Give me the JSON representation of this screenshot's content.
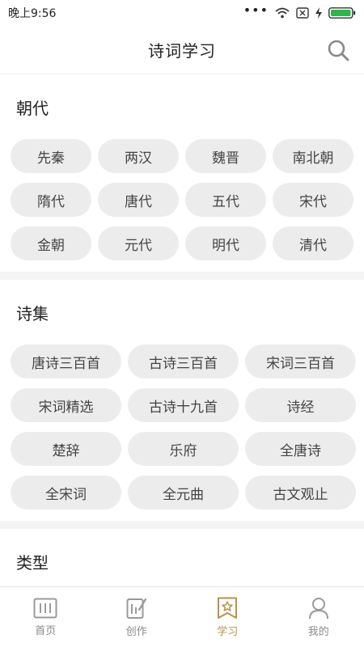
{
  "status_bar": {
    "time": "晚上9:56"
  },
  "header": {
    "title": "诗词学习"
  },
  "sections": {
    "dynasty": {
      "title": "朝代",
      "items": [
        "先秦",
        "两汉",
        "魏晋",
        "南北朝",
        "隋代",
        "唐代",
        "五代",
        "宋代",
        "金朝",
        "元代",
        "明代",
        "清代"
      ]
    },
    "collections": {
      "title": "诗集",
      "items": [
        "唐诗三百首",
        "古诗三百首",
        "宋词三百首",
        "宋词精选",
        "古诗十九首",
        "诗经",
        "楚辞",
        "乐府",
        "全唐诗",
        "全宋词",
        "全元曲",
        "古文观止"
      ]
    },
    "types": {
      "title": "类型"
    }
  },
  "bottom_nav": {
    "items": [
      {
        "label": "首页",
        "icon": "home-icon",
        "active": false
      },
      {
        "label": "创作",
        "icon": "compose-icon",
        "active": false
      },
      {
        "label": "学习",
        "icon": "study-icon",
        "active": true
      },
      {
        "label": "我的",
        "icon": "profile-icon",
        "active": false
      }
    ]
  },
  "colors": {
    "accent": "#b9914a",
    "chip_bg": "#ececec",
    "divider": "#f4f4f4"
  }
}
